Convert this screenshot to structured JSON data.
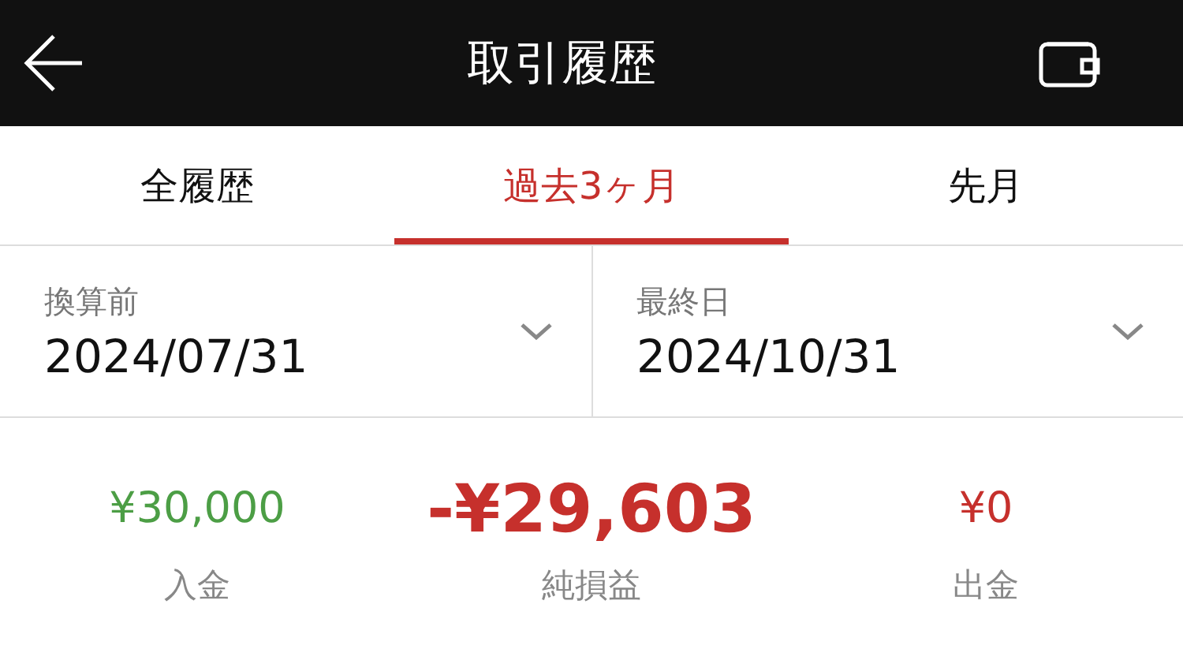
{
  "header": {
    "title": "取引履歴"
  },
  "tabs": [
    {
      "label": "全履歴",
      "selected": false
    },
    {
      "label": "過去3ヶ月",
      "selected": true
    },
    {
      "label": "先月",
      "selected": false
    }
  ],
  "date_range": [
    {
      "label": "換算前",
      "value": "2024/07/31"
    },
    {
      "label": "最終日",
      "value": "2024/10/31"
    }
  ],
  "summary": [
    {
      "kind": "deposit",
      "value": "¥30,000",
      "label": "入金"
    },
    {
      "kind": "net",
      "value": "-¥29,603",
      "label": "純損益"
    },
    {
      "kind": "withdrawal",
      "value": "¥0",
      "label": "出金"
    }
  ]
}
